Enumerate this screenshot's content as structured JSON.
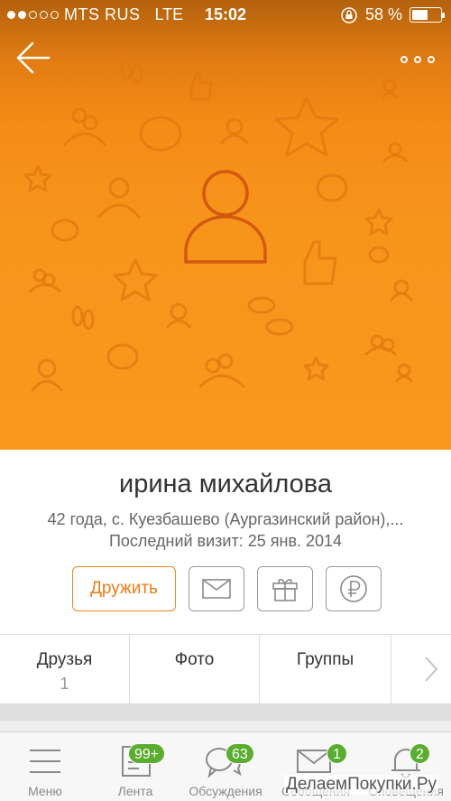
{
  "status_bar": {
    "carrier": "MTS RUS",
    "network": "LTE",
    "time": "15:02",
    "battery": "58 %",
    "battery_level": 0.58,
    "signal_bars_filled": 2,
    "signal_bars_total": 5
  },
  "header": {
    "back_icon": "arrow-left-icon",
    "more_icon": "more-dots-icon"
  },
  "profile": {
    "name": "ирина михайлова",
    "details": "42 года, с. Куезбашево (Аургазинский район),...",
    "last_visit": "Последний визит: 25 янв. 2014",
    "avatar_icon": "user-placeholder-icon"
  },
  "actions": {
    "friend_label": "Дружить",
    "message_icon": "envelope-icon",
    "gift_icon": "gift-icon",
    "money_icon": "ruble-icon"
  },
  "tabs": [
    {
      "label": "Друзья",
      "count": "1"
    },
    {
      "label": "Фото",
      "count": ""
    },
    {
      "label": "Группы",
      "count": ""
    }
  ],
  "bottom_nav": [
    {
      "label": "Меню",
      "icon": "hamburger-icon",
      "badge": ""
    },
    {
      "label": "Лента",
      "icon": "feed-icon",
      "badge": "99+"
    },
    {
      "label": "Обсуждения",
      "icon": "discussions-icon",
      "badge": "63"
    },
    {
      "label": "Сообщения",
      "icon": "envelope-icon",
      "badge": "1"
    },
    {
      "label": "Оповещения",
      "icon": "bell-icon",
      "badge": "2"
    }
  ],
  "watermark": "ДелаемПокупки.Ру",
  "colors": {
    "accent": "#f7951b",
    "friend_button": "#ee7d14",
    "badge": "#59ad2f",
    "avatar_outline": "#d2590e"
  }
}
